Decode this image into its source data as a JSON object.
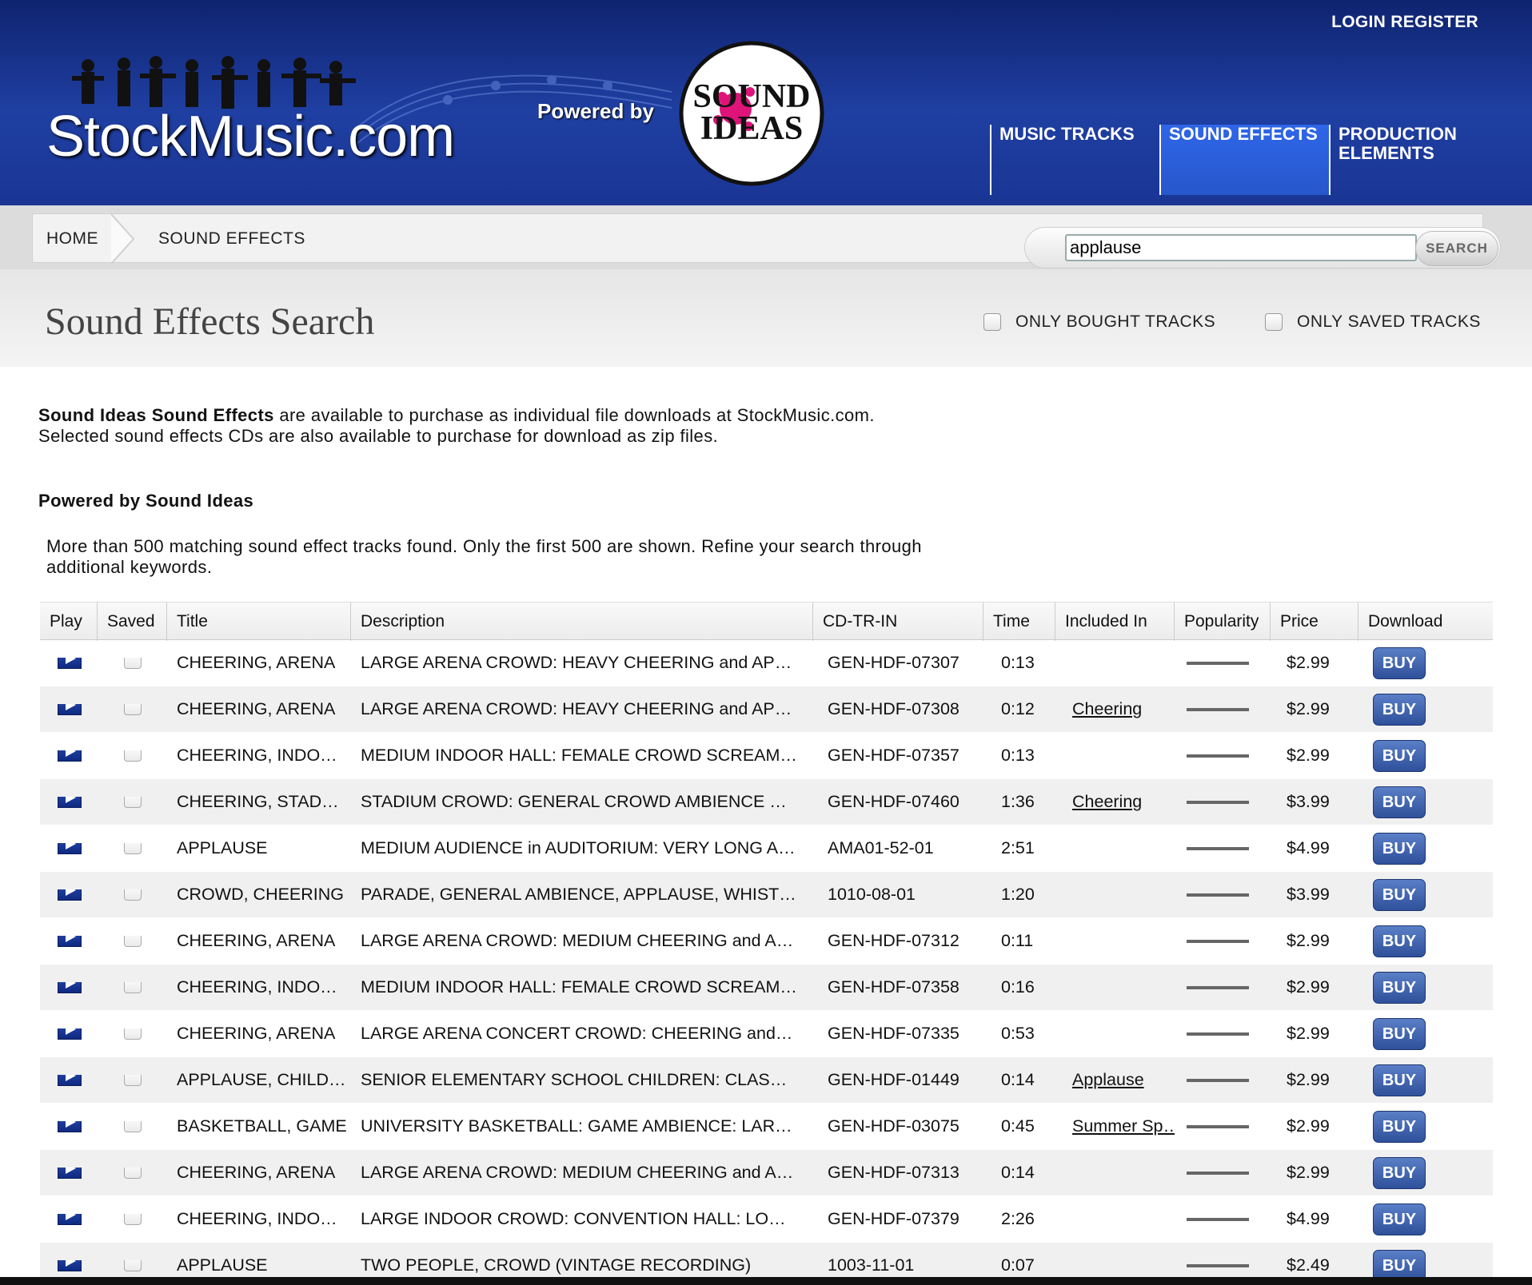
{
  "auth": {
    "login": "LOGIN",
    "register": "REGISTER"
  },
  "brand": {
    "logo_text": "StockMusic.com",
    "powered_by": "Powered by",
    "partner_logo": "SOUND IDEAS"
  },
  "nav": [
    {
      "label": "MUSIC TRACKS",
      "active": false
    },
    {
      "label": "SOUND EFFECTS",
      "active": true
    },
    {
      "label": "PRODUCTION ELEMENTS",
      "active": false
    }
  ],
  "breadcrumb": {
    "home": "HOME",
    "current": "SOUND EFFECTS"
  },
  "search": {
    "value": "applause",
    "button": "SEARCH"
  },
  "page_title": "Sound Effects Search",
  "filters": {
    "bought": "ONLY BOUGHT TRACKS",
    "saved": "ONLY SAVED TRACKS"
  },
  "intro": {
    "bold": "Sound Ideas Sound Effects",
    "line1_rest": " are available to purchase as individual file downloads at StockMusic.com.",
    "line2": "Selected sound effects CDs are also available to purchase for download as zip files."
  },
  "powered_heading": "Powered by Sound Ideas",
  "notice": "More than 500 matching sound effect tracks found. Only the first 500 are shown. Refine your search through additional keywords.",
  "table": {
    "headers": {
      "play": "Play",
      "saved": "Saved",
      "title": "Title",
      "description": "Description",
      "cd": "CD-TR-IN",
      "time": "Time",
      "included": "Included In",
      "popularity": "Popularity",
      "price": "Price",
      "download": "Download"
    },
    "buy_label": "BUY",
    "rows": [
      {
        "title": "CHEERING, ARENA",
        "description": "LARGE ARENA CROWD: HEAVY CHEERING and AP…",
        "cd": "GEN-HDF-07307",
        "time": "0:13",
        "included": "",
        "price": "$2.99"
      },
      {
        "title": "CHEERING, ARENA",
        "description": "LARGE ARENA CROWD: HEAVY CHEERING and AP…",
        "cd": "GEN-HDF-07308",
        "time": "0:12",
        "included": "Cheering",
        "price": "$2.99"
      },
      {
        "title": "CHEERING, INDO…",
        "description": "MEDIUM INDOOR HALL: FEMALE CROWD SCREAM…",
        "cd": "GEN-HDF-07357",
        "time": "0:13",
        "included": "",
        "price": "$2.99"
      },
      {
        "title": "CHEERING, STAD…",
        "description": "STADIUM CROWD: GENERAL CROWD AMBIENCE …",
        "cd": "GEN-HDF-07460",
        "time": "1:36",
        "included": "Cheering",
        "price": "$3.99"
      },
      {
        "title": "APPLAUSE",
        "description": "MEDIUM AUDIENCE in AUDITORIUM: VERY LONG A…",
        "cd": "AMA01-52-01",
        "time": "2:51",
        "included": "",
        "price": "$4.99"
      },
      {
        "title": "CROWD, CHEERING",
        "description": "PARADE, GENERAL AMBIENCE, APPLAUSE, WHIST…",
        "cd": "1010-08-01",
        "time": "1:20",
        "included": "",
        "price": "$3.99"
      },
      {
        "title": "CHEERING, ARENA",
        "description": "LARGE ARENA CROWD: MEDIUM CHEERING and A…",
        "cd": "GEN-HDF-07312",
        "time": "0:11",
        "included": "",
        "price": "$2.99"
      },
      {
        "title": "CHEERING, INDO…",
        "description": "MEDIUM INDOOR HALL: FEMALE CROWD SCREAM…",
        "cd": "GEN-HDF-07358",
        "time": "0:16",
        "included": "",
        "price": "$2.99"
      },
      {
        "title": "CHEERING, ARENA",
        "description": "LARGE ARENA CONCERT CROWD: CHEERING and…",
        "cd": "GEN-HDF-07335",
        "time": "0:53",
        "included": "",
        "price": "$2.99"
      },
      {
        "title": "APPLAUSE, CHILD…",
        "description": "SENIOR ELEMENTARY SCHOOL CHILDREN: CLAS…",
        "cd": "GEN-HDF-01449",
        "time": "0:14",
        "included": "Applause",
        "price": "$2.99"
      },
      {
        "title": "BASKETBALL, GAME",
        "description": "UNIVERSITY BASKETBALL: GAME AMBIENCE: LAR…",
        "cd": "GEN-HDF-03075",
        "time": "0:45",
        "included": "Summer Sp…",
        "price": "$2.99"
      },
      {
        "title": "CHEERING, ARENA",
        "description": "LARGE ARENA CROWD: MEDIUM CHEERING and A…",
        "cd": "GEN-HDF-07313",
        "time": "0:14",
        "included": "",
        "price": "$2.99"
      },
      {
        "title": "CHEERING, INDO…",
        "description": "LARGE INDOOR CROWD: CONVENTION HALL: LO…",
        "cd": "GEN-HDF-07379",
        "time": "2:26",
        "included": "",
        "price": "$4.99"
      },
      {
        "title": "APPLAUSE",
        "description": "TWO PEOPLE, CROWD (VINTAGE RECORDING)",
        "cd": "1003-11-01",
        "time": "0:07",
        "included": "",
        "price": "$2.49"
      }
    ]
  },
  "colors": {
    "header_blue": "#1f3fa2",
    "nav_active": "#2f66e8",
    "buy_button": "#3f62ae"
  }
}
